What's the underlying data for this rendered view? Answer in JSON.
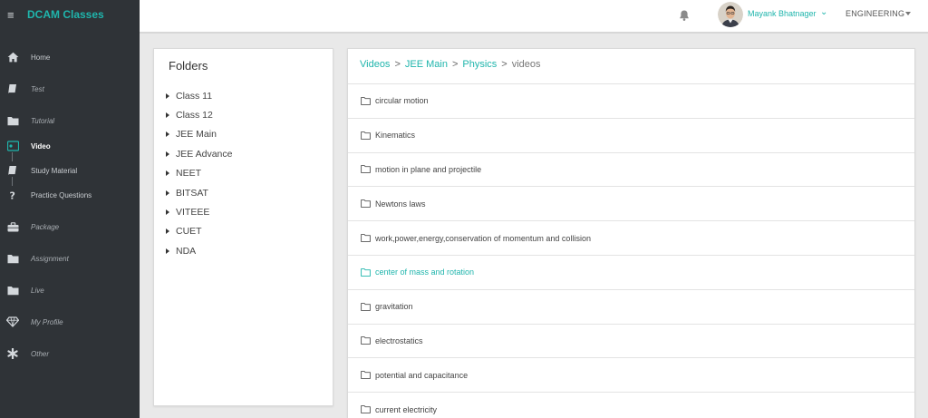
{
  "brand": {
    "name": "DCAM Classes",
    "menu_icon": "hamburger-icon"
  },
  "sidebar": {
    "items": [
      {
        "label": "Home",
        "icon": "home-icon",
        "style": "normal"
      },
      {
        "label": "Test",
        "icon": "book-icon",
        "style": "italic"
      },
      {
        "label": "Tutorial",
        "icon": "folder-icon",
        "style": "italic"
      },
      {
        "label": "Video",
        "icon": "video-icon",
        "style": "active"
      },
      {
        "label": "Study Material",
        "icon": "book-icon",
        "style": "normal"
      },
      {
        "label": "Practice Questions",
        "icon": "question-icon",
        "style": "normal"
      },
      {
        "label": "Package",
        "icon": "briefcase-icon",
        "style": "italic"
      },
      {
        "label": "Assignment",
        "icon": "folder-icon",
        "style": "italic"
      },
      {
        "label": "Live",
        "icon": "folder-icon",
        "style": "italic"
      },
      {
        "label": "My Profile",
        "icon": "diamond-icon",
        "style": "italic"
      },
      {
        "label": "Other",
        "icon": "asterisk-icon",
        "style": "italic"
      }
    ]
  },
  "header": {
    "user_name": "Mayank Bhatnager",
    "department": "ENGINEERING",
    "icons": {
      "notification": "bell-icon",
      "user_caret": "chevron-down-icon",
      "dept_caret": "caret-down-icon"
    }
  },
  "folders": {
    "title": "Folders",
    "items": [
      "Class 11",
      "Class 12",
      "JEE Main",
      "JEE Advance",
      "NEET",
      "BITSAT",
      "VITEEE",
      "CUET",
      "NDA"
    ]
  },
  "breadcrumb": {
    "items": [
      {
        "label": "Videos",
        "link": true
      },
      {
        "label": "JEE Main",
        "link": true
      },
      {
        "label": "Physics",
        "link": true
      },
      {
        "label": "videos",
        "link": false
      }
    ],
    "separator": ">"
  },
  "videos": {
    "items": [
      {
        "label": "circular motion",
        "highlight": false
      },
      {
        "label": "Kinematics",
        "highlight": false
      },
      {
        "label": "motion in plane and projectile",
        "highlight": false
      },
      {
        "label": "Newtons laws",
        "highlight": false
      },
      {
        "label": "work,power,energy,conservation of momentum and collision",
        "highlight": false
      },
      {
        "label": "center of mass and rotation",
        "highlight": true
      },
      {
        "label": "gravitation",
        "highlight": false
      },
      {
        "label": "electrostatics",
        "highlight": false
      },
      {
        "label": "potential and capacitance",
        "highlight": false
      },
      {
        "label": "current electricity",
        "highlight": false
      }
    ]
  },
  "colors": {
    "accent": "#1fb5ac",
    "sidebar_bg": "#2f3337",
    "page_bg": "#e9e9e9"
  }
}
